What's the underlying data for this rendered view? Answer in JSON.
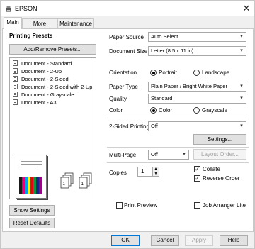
{
  "window": {
    "title": "EPSON"
  },
  "tabs": [
    {
      "label": "Main"
    },
    {
      "label": "More Options"
    },
    {
      "label": "Maintenance"
    }
  ],
  "presets": {
    "heading": "Printing Presets",
    "add_remove_label": "Add/Remove Presets...",
    "items": [
      {
        "label": "Document - Standard"
      },
      {
        "label": "Document - 2-Up"
      },
      {
        "label": "Document - 2-Sided"
      },
      {
        "label": "Document - 2-Sided with 2-Up"
      },
      {
        "label": "Document - Grayscale"
      },
      {
        "label": "Document - A3"
      }
    ],
    "show_settings_label": "Show Settings",
    "reset_defaults_label": "Reset Defaults"
  },
  "settings": {
    "paper_source": {
      "label": "Paper Source",
      "value": "Auto Select"
    },
    "document_size": {
      "label": "Document Size",
      "value": "Letter (8.5 x 11 in)"
    },
    "orientation": {
      "label": "Orientation",
      "options": [
        "Portrait",
        "Landscape"
      ],
      "selected": "Portrait"
    },
    "paper_type": {
      "label": "Paper Type",
      "value": "Plain Paper / Bright White Paper"
    },
    "quality": {
      "label": "Quality",
      "value": "Standard"
    },
    "color": {
      "label": "Color",
      "options": [
        "Color",
        "Grayscale"
      ],
      "selected": "Color"
    },
    "two_sided": {
      "label": "2-Sided Printing",
      "value": "Off",
      "settings_label": "Settings..."
    },
    "multi_page": {
      "label": "Multi-Page",
      "value": "Off",
      "layout_order_label": "Layout Order..."
    },
    "copies": {
      "label": "Copies",
      "value": "1"
    },
    "collate": {
      "label": "Collate",
      "checked": true
    },
    "reverse_order": {
      "label": "Reverse Order",
      "checked": true
    },
    "print_preview": {
      "label": "Print Preview",
      "checked": false
    },
    "job_arranger": {
      "label": "Job Arranger Lite",
      "checked": false
    }
  },
  "footer": {
    "ok": "OK",
    "cancel": "Cancel",
    "apply": "Apply",
    "help": "Help"
  },
  "colors": {
    "accent": "#0078d7",
    "window_bg": "#f0f0f0"
  },
  "icons": {
    "app": "printer-app-icon",
    "close": "close-icon",
    "dropdown": "chevron-down-icon"
  }
}
